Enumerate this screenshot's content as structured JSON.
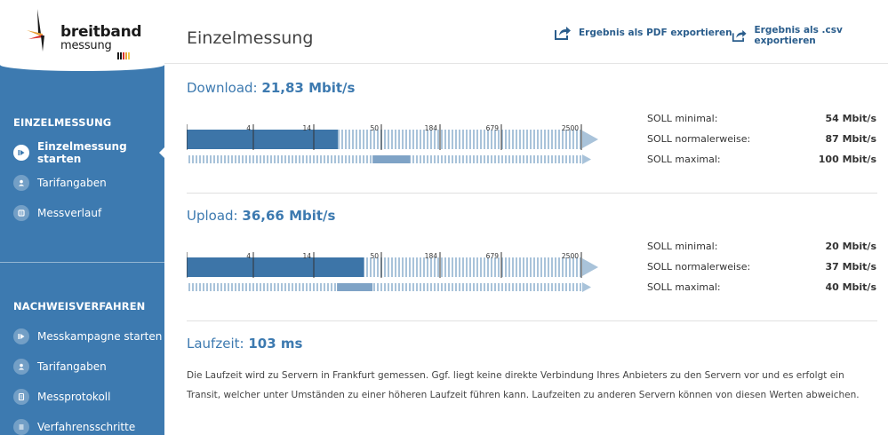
{
  "logo": {
    "line1": "breitband",
    "line2": "messung"
  },
  "sidebar": {
    "section1": {
      "heading": "EINZELMESSUNG",
      "items": [
        {
          "label": "Einzelmessung starten",
          "icon": "play-icon",
          "active": true
        },
        {
          "label": "Tarifangaben",
          "icon": "user-card-icon",
          "active": false
        },
        {
          "label": "Messverlauf",
          "icon": "history-icon",
          "active": false
        }
      ]
    },
    "section2": {
      "heading": "NACHWEISVERFAHREN",
      "items": [
        {
          "label": "Messkampagne starten",
          "icon": "play-icon"
        },
        {
          "label": "Tarifangaben",
          "icon": "user-card-icon"
        },
        {
          "label": "Messprotokoll",
          "icon": "protocol-icon"
        },
        {
          "label": "Verfahrensschritte",
          "icon": "steps-icon"
        }
      ]
    }
  },
  "header": {
    "title": "Einzelmessung",
    "export_pdf": "Ergebnis als PDF exportieren",
    "export_csv": "Ergebnis als .csv exportieren"
  },
  "scale_ticks": [
    "4",
    "14",
    "50",
    "184",
    "679",
    "2500"
  ],
  "download": {
    "label": "Download:",
    "value": "21,83 Mbit/s",
    "bar_fraction": 0.382,
    "soll_range": [
      0.47,
      0.565
    ],
    "soll": [
      {
        "label": "SOLL minimal:",
        "value": "54 Mbit/s"
      },
      {
        "label": "SOLL normalerweise:",
        "value": "87 Mbit/s"
      },
      {
        "label": "SOLL maximal:",
        "value": "100 Mbit/s"
      }
    ]
  },
  "upload": {
    "label": "Upload:",
    "value": "36,66 Mbit/s",
    "bar_fraction": 0.448,
    "soll_range": [
      0.38,
      0.47
    ],
    "soll": [
      {
        "label": "SOLL minimal:",
        "value": "20 Mbit/s"
      },
      {
        "label": "SOLL normalerweise:",
        "value": "37 Mbit/s"
      },
      {
        "label": "SOLL maximal:",
        "value": "40 Mbit/s"
      }
    ]
  },
  "latency": {
    "label": "Laufzeit:",
    "value": "103 ms",
    "note": "Die Laufzeit wird zu Servern in Frankfurt gemessen. Ggf. liegt keine direkte Verbindung Ihres Anbieters zu den Servern vor und es erfolgt ein Transit, welcher unter Umständen zu einer höheren Laufzeit führen kann. Laufzeiten zu anderen Servern können von diesen Werten abweichen."
  },
  "colors": {
    "sidebar": "#3d7ab0",
    "bar_fill": "#3d75a8",
    "bar_track": "#a9c3da",
    "soll_band": "#7fa3c6",
    "accent_text": "#3d7ab0"
  }
}
